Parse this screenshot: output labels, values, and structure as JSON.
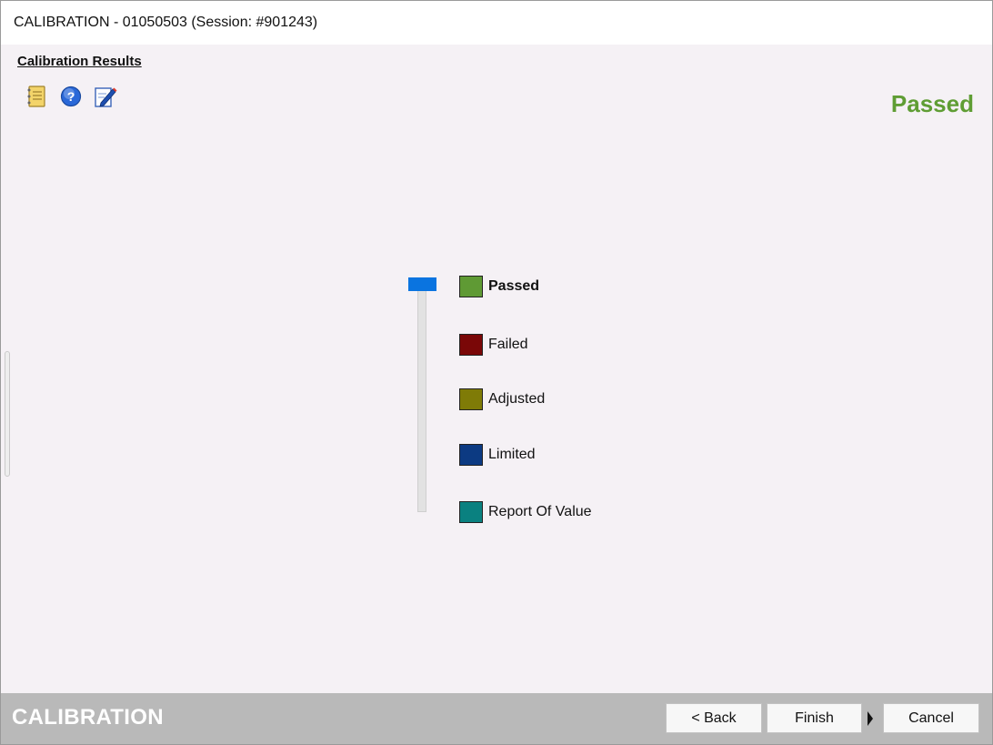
{
  "window": {
    "title": "CALIBRATION - 01050503 (Session: #901243)"
  },
  "section": {
    "title": "Calibration Results"
  },
  "toolbar": {
    "icons": [
      "notebook-icon",
      "help-icon",
      "edit-icon"
    ]
  },
  "status": {
    "text": "Passed",
    "color": "#5f9d34"
  },
  "slider": {
    "selected_index": 0
  },
  "legend": [
    {
      "label": "Passed",
      "color": "#5f9a34",
      "active": true
    },
    {
      "label": "Failed",
      "color": "#7a0707",
      "active": false
    },
    {
      "label": "Adjusted",
      "color": "#7f7b07",
      "active": false
    },
    {
      "label": "Limited",
      "color": "#0c3a82",
      "active": false
    },
    {
      "label": "Report Of Value",
      "color": "#0a8180",
      "active": false
    }
  ],
  "footer": {
    "brand": "CALIBRATION",
    "back_label": "< Back",
    "finish_label": "Finish",
    "cancel_label": "Cancel"
  }
}
